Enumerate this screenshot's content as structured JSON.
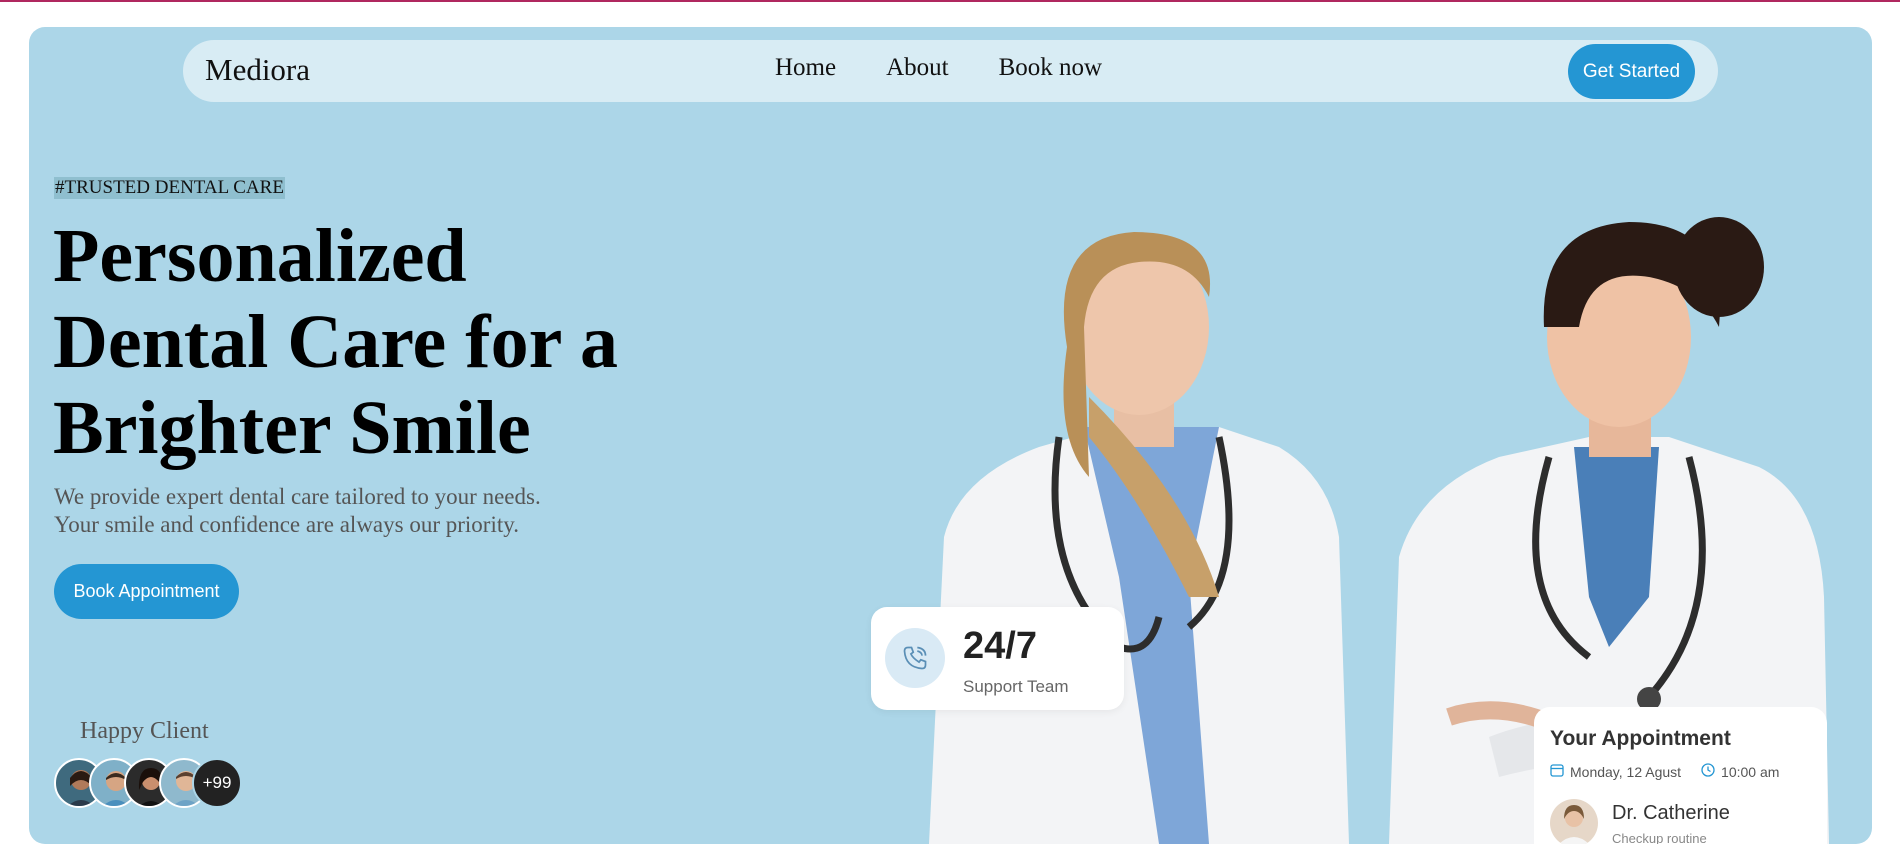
{
  "nav": {
    "brand": "Mediora",
    "links": [
      "Home",
      "About",
      "Book now"
    ],
    "cta": "Get Started"
  },
  "hero": {
    "tag": "#TRUSTED DENTAL CARE",
    "headline": "Personalized Dental Care for a Brighter Smile",
    "subtext_line1": "We provide expert dental care tailored to your needs.",
    "subtext_line2": "Your smile and confidence are always our priority.",
    "button": "Book Appointment",
    "happy_label": "Happy Client",
    "avatars_more": "+99"
  },
  "support_card": {
    "title": "24/7",
    "subtitle": "Support Team"
  },
  "appointment_card": {
    "title": "Your Appointment",
    "date": "Monday, 12 Agust",
    "time": "10:00 am",
    "doctor": "Dr. Catherine",
    "note": "Checkup routine"
  },
  "colors": {
    "hero_bg": "#acd6e8",
    "nav_bg": "#d8ecf4",
    "accent": "#2496d3"
  }
}
